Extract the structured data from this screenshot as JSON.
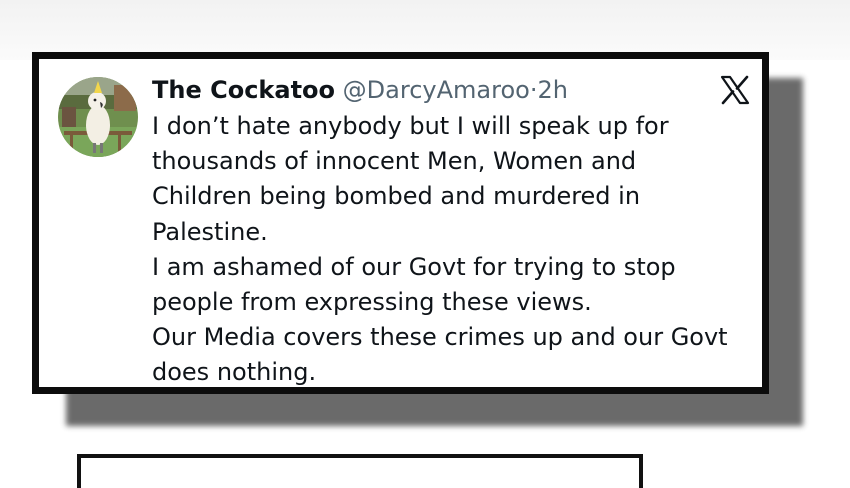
{
  "tweet": {
    "author_name": "The Cockatoo",
    "handle": "@DarcyAmaroo",
    "separator": "·",
    "time": "2h",
    "platform_icon": "x-logo-icon",
    "avatar_icon": "cockatoo-avatar",
    "lines": [
      "I don’t hate anybody but I will speak up for",
      "thousands of innocent Men, Women and",
      "Children being bombed and murdered in",
      "Palestine.",
      "I am ashamed of our Govt for trying to stop",
      "people from expressing these views.",
      "Our Media covers these crimes up and our Govt",
      "does nothing."
    ]
  },
  "colors": {
    "text": "#0f1419",
    "secondary_text": "#536471",
    "card_border": "#0c0c0c",
    "shadow": "#5a5a5a"
  }
}
